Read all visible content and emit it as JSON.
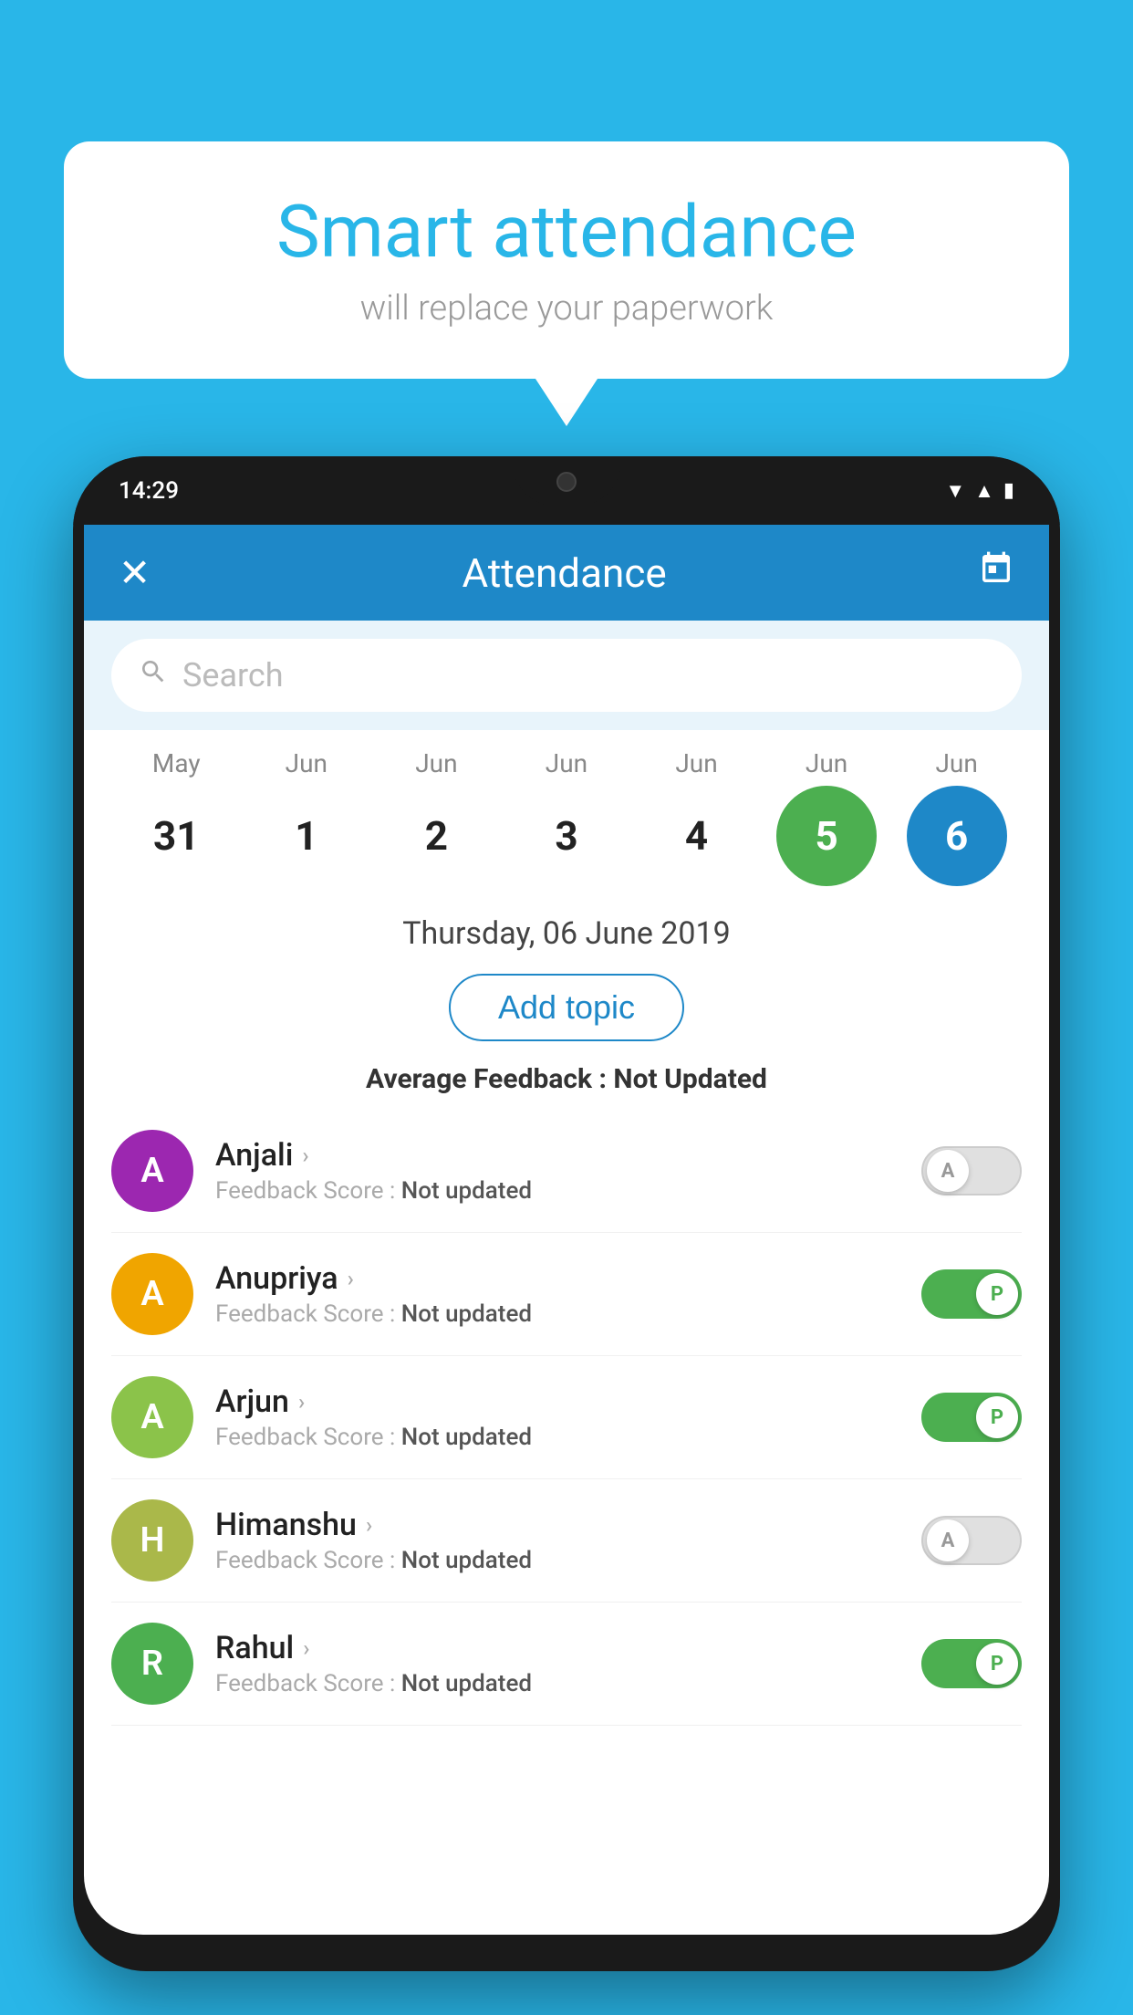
{
  "background_color": "#29b6e8",
  "bubble": {
    "title": "Smart attendance",
    "subtitle": "will replace your paperwork"
  },
  "phone": {
    "status_bar": {
      "time": "14:29",
      "icons": [
        "wifi",
        "signal",
        "battery"
      ]
    },
    "header": {
      "title": "Attendance",
      "close_icon": "×",
      "calendar_icon": "📅"
    },
    "search": {
      "placeholder": "Search"
    },
    "calendar": {
      "months": [
        "May",
        "Jun",
        "Jun",
        "Jun",
        "Jun",
        "Jun",
        "Jun"
      ],
      "dates": [
        {
          "day": "31",
          "state": "normal"
        },
        {
          "day": "1",
          "state": "normal"
        },
        {
          "day": "2",
          "state": "normal"
        },
        {
          "day": "3",
          "state": "normal"
        },
        {
          "day": "4",
          "state": "normal"
        },
        {
          "day": "5",
          "state": "today"
        },
        {
          "day": "6",
          "state": "selected"
        }
      ]
    },
    "selected_date": "Thursday, 06 June 2019",
    "add_topic_label": "Add topic",
    "avg_feedback_label": "Average Feedback :",
    "avg_feedback_value": "Not Updated",
    "students": [
      {
        "name": "Anjali",
        "avatar_letter": "A",
        "avatar_color": "#9c27b0",
        "feedback_label": "Feedback Score :",
        "feedback_value": "Not updated",
        "attendance": "absent"
      },
      {
        "name": "Anupriya",
        "avatar_letter": "A",
        "avatar_color": "#f0a500",
        "feedback_label": "Feedback Score :",
        "feedback_value": "Not updated",
        "attendance": "present"
      },
      {
        "name": "Arjun",
        "avatar_letter": "A",
        "avatar_color": "#8bc34a",
        "feedback_label": "Feedback Score :",
        "feedback_value": "Not updated",
        "attendance": "present"
      },
      {
        "name": "Himanshu",
        "avatar_letter": "H",
        "avatar_color": "#aab84a",
        "feedback_label": "Feedback Score :",
        "feedback_value": "Not updated",
        "attendance": "absent"
      },
      {
        "name": "Rahul",
        "avatar_letter": "R",
        "avatar_color": "#4caf50",
        "feedback_label": "Feedback Score :",
        "feedback_value": "Not updated",
        "attendance": "present"
      }
    ]
  }
}
